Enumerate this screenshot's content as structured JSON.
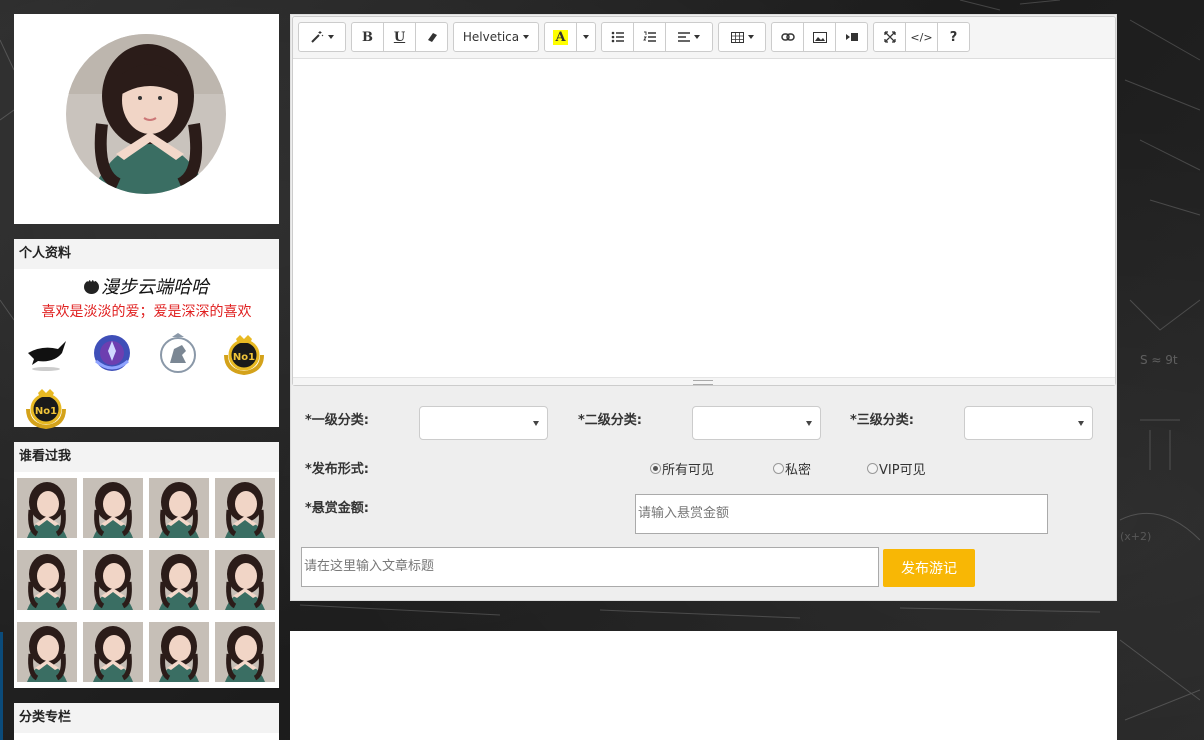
{
  "avatar": {
    "alt": "user-avatar"
  },
  "profile": {
    "heading": "个人资料",
    "name": "漫步云端哈哈",
    "motto": "喜欢是淡淡的爱；爱是深深的喜欢",
    "badges": [
      "dolphin-badge-icon",
      "blue-crest-badge-icon",
      "knight-emblem-badge-icon",
      "no1-crown-badge-icon",
      "no1-crown-badge-icon"
    ]
  },
  "visitors": {
    "heading": "谁看过我",
    "count": 12
  },
  "category": {
    "heading": "分类专栏"
  },
  "toolbar": {
    "font_name": "Helvetica",
    "bold": "B",
    "underline": "U",
    "highlight": "A",
    "code": "</>",
    "help": "?"
  },
  "form": {
    "cat1_label": "*一级分类:",
    "cat2_label": "*二级分类:",
    "cat3_label": "*三级分类:",
    "publish_label": "*发布形式:",
    "visibility_options": [
      "所有可见",
      "私密",
      "VIP可见"
    ],
    "visibility_selected": "所有可见",
    "reward_label": "*悬赏金额:",
    "reward_placeholder": "请输入悬赏金额",
    "title_placeholder": "请在这里输入文章标题",
    "submit_label": "发布游记"
  },
  "colors": {
    "accent": "#f8b705",
    "motto": "#e02020"
  }
}
